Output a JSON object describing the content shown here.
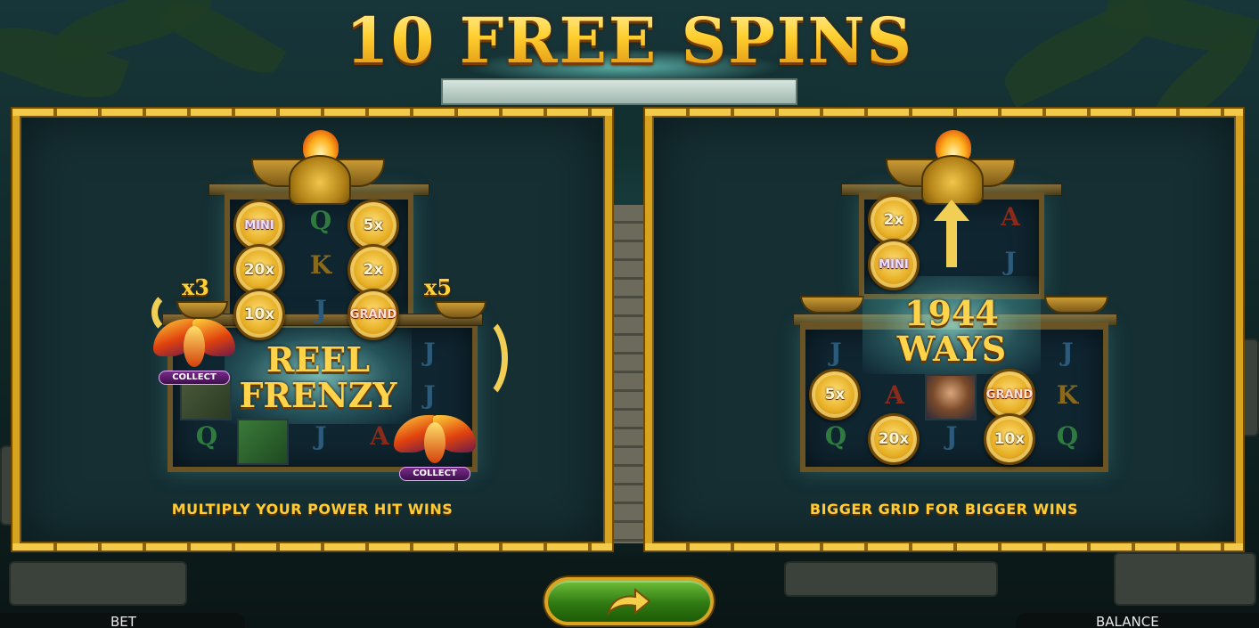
{
  "title": "10 FREE SPINS",
  "left_panel": {
    "caption": "MULTIPLY YOUR POWER HIT WINS",
    "feature_label_line1": "REEL",
    "feature_label_line2": "FRENZY",
    "multiplier_left": "x3",
    "multiplier_right": "x5",
    "collect_label": "COLLECT",
    "coins": [
      "MINI",
      "5x",
      "20x",
      "2x",
      "10x",
      "GRAND"
    ],
    "symbols": [
      "Q",
      "K",
      "J",
      "J",
      "J",
      "Q",
      "J",
      "A"
    ]
  },
  "right_panel": {
    "caption": "BIGGER GRID FOR BIGGER WINS",
    "feature_label_line1": "1944",
    "feature_label_line2": "WAYS",
    "coins": [
      "2x",
      "MINI",
      "5x",
      "GRAND",
      "20x",
      "10x"
    ],
    "symbols": [
      "A",
      "J",
      "J",
      "J",
      "K",
      "A",
      "Q",
      "J",
      "Q"
    ]
  },
  "bottom": {
    "bet_label": "BET",
    "balance_label": "BALANCE"
  },
  "colors": {
    "gold": "#ffd23a",
    "play_button": "#2f7a12",
    "panel_bg": "#152f33"
  }
}
